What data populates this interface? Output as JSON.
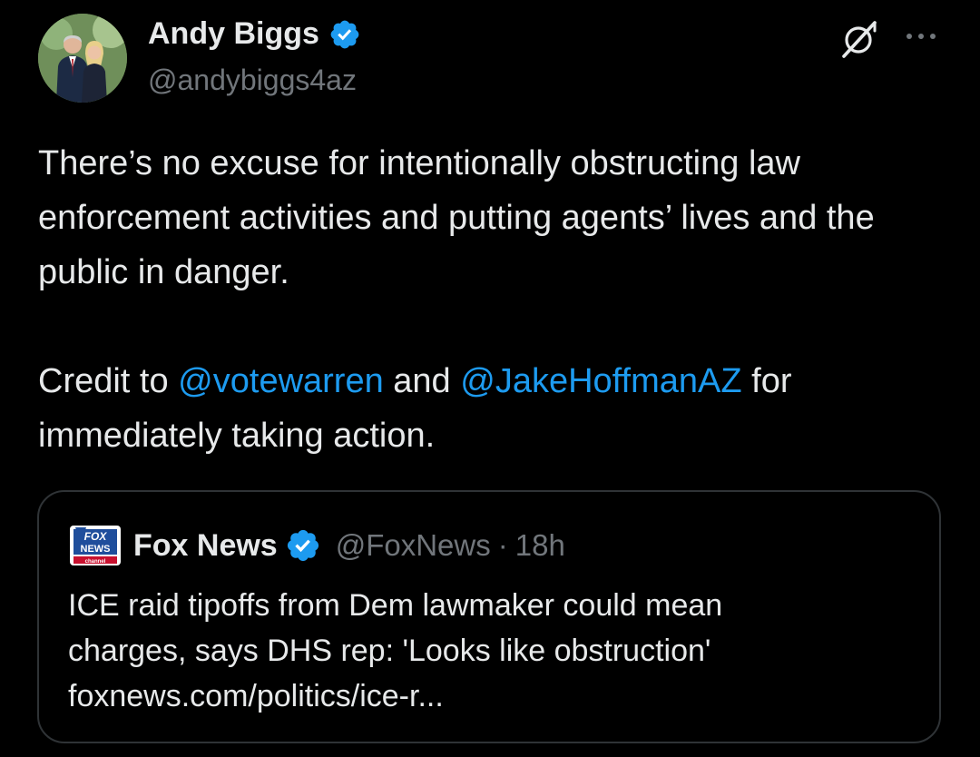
{
  "tweet": {
    "author": {
      "name": "Andy Biggs",
      "handle": "@andybiggs4az",
      "verified": true
    },
    "text_part1": "There’s no excuse for intentionally obstructing law enforcement activities and putting agents’ lives and the public in danger.\n\nCredit to ",
    "mention1": "@votewarren",
    "text_part2": " and ",
    "mention2": "@JakeHoffmanAZ",
    "text_part3": " for immediately taking action.",
    "icons": {
      "grok": "grok-icon",
      "more": "more-options-icon"
    }
  },
  "quote": {
    "author": {
      "name": "Fox News",
      "handle": "@FoxNews",
      "verified": true,
      "logo_text": "FOX NEWS",
      "logo_subtext": "channel"
    },
    "separator": "·",
    "time": "18h",
    "line1": "ICE raid tipoffs from Dem lawmaker could mean",
    "line2": "charges, says DHS rep: 'Looks like obstruction'",
    "link": "foxnews.com/politics/ice-r..."
  },
  "colors": {
    "background": "#000000",
    "text": "#e7e9ea",
    "secondary": "#71767b",
    "accent": "#1d9bf0",
    "border": "#2f3336"
  }
}
